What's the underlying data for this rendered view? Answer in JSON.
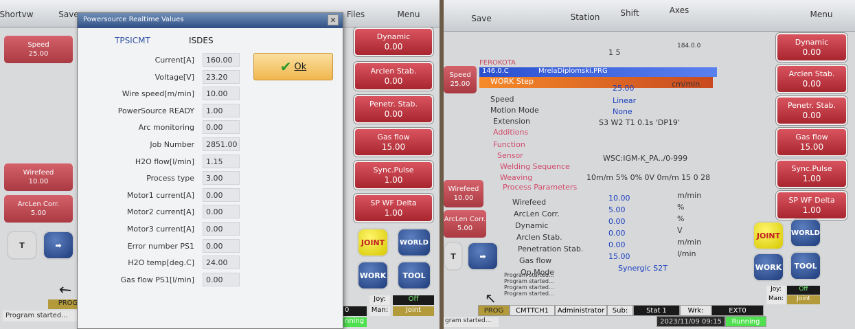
{
  "left": {
    "topbar": {
      "shortvw": "Shortvw",
      "save": "Save",
      "files": "Files",
      "menu": "Menu"
    },
    "side": [
      {
        "label": "Speed",
        "value": "25.00"
      },
      {
        "label": "Wirefeed",
        "value": "10.00"
      },
      {
        "label": "ArcLen Corr.",
        "value": "5.00"
      }
    ],
    "right_buttons": [
      {
        "label": "Dynamic",
        "value": "0.00"
      },
      {
        "label": "Arclen Stab.",
        "value": "0.00"
      },
      {
        "label": "Penetr. Stab.",
        "value": "0.00"
      },
      {
        "label": "Gas flow",
        "value": "15.00"
      },
      {
        "label": "Sync.Pulse",
        "value": "1.00"
      },
      {
        "label": "SP WF Delta",
        "value": "1.00"
      }
    ],
    "coord_buttons": {
      "joint": "JOINT",
      "world": "WORLD",
      "work": "WORK",
      "tool": "TOOL"
    },
    "joy_label": "Joy:",
    "joy_value": "Off",
    "man_label": "Man:",
    "man_value": "Joint",
    "prog": "PROG",
    "status_msg": "Program started...",
    "running": "nning",
    "zero": "0"
  },
  "dialog": {
    "title": "Powersource Realtime Values",
    "close": "✕",
    "col1": "TPSICMT",
    "col2": "ISDES",
    "ok": "Ok",
    "rows": [
      {
        "label": "Current[A]",
        "value": "160.00"
      },
      {
        "label": "Voltage[V]",
        "value": "23.20"
      },
      {
        "label": "Wire speed[m/min]",
        "value": "10.00"
      },
      {
        "label": "PowerSource READY",
        "value": "1.00"
      },
      {
        "label": "Arc monitoring",
        "value": "0.00"
      },
      {
        "label": "Job Number",
        "value": "2851.00"
      },
      {
        "label": "H2O flow[l/min]",
        "value": "1.15"
      },
      {
        "label": "Process type",
        "value": "3.00"
      },
      {
        "label": "Motor1 current[A]",
        "value": "0.00"
      },
      {
        "label": "Motor2 current[A]",
        "value": "0.00"
      },
      {
        "label": "Motor3 current[A]",
        "value": "0.00"
      },
      {
        "label": "Error number PS1",
        "value": "0.00"
      },
      {
        "label": "H2O temp[deg.C]",
        "value": "24.00"
      },
      {
        "label": "Gas flow PS1[l/min]",
        "value": "0.00"
      }
    ]
  },
  "right": {
    "topbar": {
      "save": "Save",
      "station": "Station",
      "shift": "Shift",
      "axes": "Axes",
      "menu": "Menu"
    },
    "counter": "1 5",
    "coord": "184.0.0",
    "project": "FEROKOTA",
    "file_pos": "146.0.C",
    "file_name": "MrelaDiplomski.PRG",
    "work_step": "WORK Step",
    "unit_cm": "cm/min",
    "tree": [
      {
        "label": "Speed",
        "value": "25.00"
      },
      {
        "label": "Motion Mode",
        "value": "Linear"
      },
      {
        "label": "Extension",
        "value": "None"
      }
    ],
    "extension_detail": "S3 W2 T1 0.1s 'DP19'",
    "additions": "Additions",
    "function": "Function",
    "sensor": "Sensor",
    "sensor_value": "WSC:IGM-K_PA../0-999",
    "welding_seq": "Welding Sequence",
    "weaving": "Weaving",
    "process_params": "Process Parameters",
    "process_summary": "10m/m 5% 0% 0V 0m/m 15 0 28",
    "params": [
      {
        "label": "Wirefeed",
        "value": "10.00",
        "unit": "m/min"
      },
      {
        "label": "ArcLen Corr.",
        "value": "5.00",
        "unit": "%"
      },
      {
        "label": "Dynamic",
        "value": "0.00",
        "unit": "%"
      },
      {
        "label": "Arclen Stab.",
        "value": "0.00",
        "unit": "V"
      },
      {
        "label": "Penetration Stab.",
        "value": "0.00",
        "unit": "m/min"
      },
      {
        "label": "Gas flow",
        "value": "15.00",
        "unit": "l/min"
      },
      {
        "label": "Op.Mode",
        "value": "Synergic S2T",
        "unit": ""
      }
    ],
    "log": [
      "Program started...",
      "Program started...",
      "Program started...",
      "Program started..."
    ],
    "side_buttons": [
      {
        "label": "Dynamic",
        "value": "0.00"
      },
      {
        "label": "Arclen Stab.",
        "value": "0.00"
      },
      {
        "label": "Penetr. Stab.",
        "value": "0.00"
      },
      {
        "label": "Gas flow",
        "value": "15.00"
      },
      {
        "label": "Sync.Pulse",
        "value": "1.00"
      },
      {
        "label": "SP WF Delta",
        "value": "1.00"
      }
    ],
    "left_side": [
      {
        "label": "Speed",
        "value": "25.00"
      },
      {
        "label": "Wirefeed",
        "value": "10.00"
      },
      {
        "label": "ArcLen Corr.",
        "value": "5.00"
      }
    ],
    "coord_buttons": {
      "joint": "JOINT",
      "world": "WORLD",
      "work": "WORK",
      "tool": "TOOL"
    },
    "joy_label": "Joy:",
    "joy_value": "Off",
    "man_label": "Man:",
    "man_value": "Joint",
    "status": {
      "prog": "PROG",
      "user": "CMTTCH1",
      "role": "Administrator",
      "sub": "Sub:",
      "stat": "Stat 1",
      "wrk": "Wrk:",
      "ext": "EXT0",
      "datetime": "2023/11/09 09:15",
      "running": "Running"
    },
    "status_msg": "gram started..."
  }
}
